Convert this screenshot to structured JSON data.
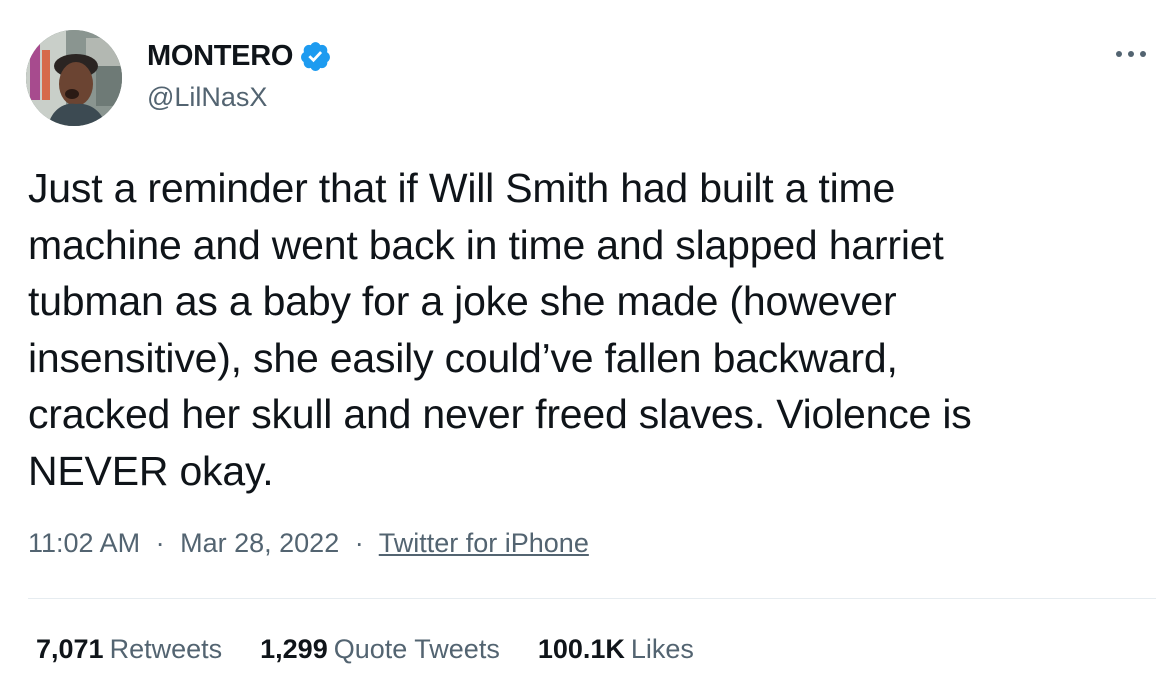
{
  "author": {
    "display_name": "MONTERO",
    "handle": "@LilNasX",
    "verified": true,
    "avatar_icon": "profile-photo"
  },
  "tweet": {
    "lines": [
      "Just a reminder that if Will Smith had built a time",
      "machine and went back in time and slapped harriet",
      "tubman as a baby for a joke she made (however",
      "insensitive), she easily could’ve fallen backward,",
      "cracked her skull and never freed slaves. Violence is",
      "NEVER okay."
    ],
    "time": "11:02 AM",
    "date": "Mar 28, 2022",
    "separator": "·",
    "source": "Twitter for iPhone"
  },
  "stats": {
    "retweets_count": "7,071",
    "retweets_label": "Retweets",
    "quotes_count": "1,299",
    "quotes_label": "Quote Tweets",
    "likes_count": "100.1K",
    "likes_label": "Likes"
  },
  "colors": {
    "text_primary": "#0f1419",
    "text_secondary": "#536471",
    "verified_blue": "#1d9bf0",
    "divider": "#e6ecf0"
  },
  "icons": {
    "verified": "verified-badge-icon",
    "more": "more-options-icon"
  }
}
